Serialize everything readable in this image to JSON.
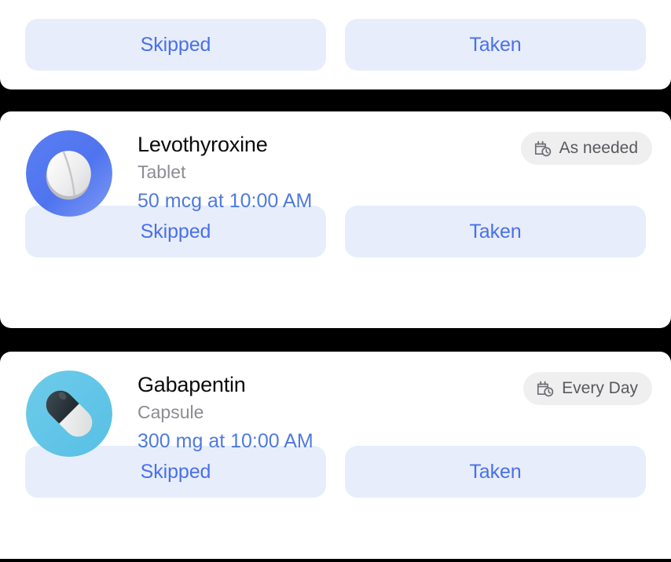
{
  "theme": {
    "page_background": "#000000",
    "card_background": "#ffffff",
    "action_button_background": "#e7edfb",
    "action_button_text": "#4a70e8",
    "badge_background": "#efeff0",
    "badge_text": "#58595d",
    "dose_text": "#4e7ae0",
    "form_text": "#8b8d92",
    "name_text": "#0b0b0d"
  },
  "actions": {
    "skipped_label": "Skipped",
    "taken_label": "Taken"
  },
  "cards": [
    {
      "id": "partial-top",
      "actions": {
        "skipped_label": "Skipped",
        "taken_label": "Taken"
      }
    },
    {
      "id": "levothyroxine",
      "name": "Levothyroxine",
      "form": "Tablet",
      "dose": "50 mcg at 10:00 AM",
      "badge": {
        "label": "As needed",
        "icon": "calendar-clock-icon"
      },
      "icon": {
        "name": "tablet-pill-icon",
        "circle_color": "#5478ef",
        "pill_color": "#e9e9ec"
      },
      "actions": {
        "skipped_label": "Skipped",
        "taken_label": "Taken"
      }
    },
    {
      "id": "gabapentin",
      "name": "Gabapentin",
      "form": "Capsule",
      "dose": "300 mg at 10:00 AM",
      "badge": {
        "label": "Every Day",
        "icon": "calendar-clock-icon"
      },
      "icon": {
        "name": "capsule-pill-icon",
        "circle_color": "#62c6e8",
        "capsule_dark": "#2e3b40",
        "capsule_light": "#eef0f0"
      },
      "actions": {
        "skipped_label": "Skipped",
        "taken_label": "Taken"
      }
    }
  ]
}
